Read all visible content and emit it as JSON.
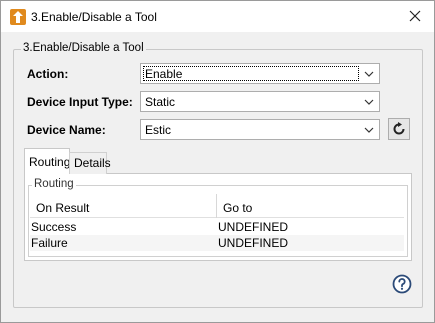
{
  "window": {
    "title": "3.Enable/Disable a Tool"
  },
  "group": {
    "legend": "3.Enable/Disable a Tool"
  },
  "fields": {
    "action": {
      "label": "Action:",
      "value": "Enable"
    },
    "device_input_type": {
      "label": "Device Input Type:",
      "value": "Static"
    },
    "device_name": {
      "label": "Device Name:",
      "value": "Estic"
    }
  },
  "tabs": [
    {
      "label": "Routing",
      "active": true
    },
    {
      "label": "Details",
      "active": false
    }
  ],
  "routing": {
    "legend": "Routing",
    "columns": [
      "On Result",
      "Go to"
    ],
    "rows": [
      {
        "result": "Success",
        "goto": "UNDEFINED"
      },
      {
        "result": "Failure",
        "goto": "UNDEFINED"
      }
    ]
  },
  "colors": {
    "window_bg": "#f0f0f0",
    "panel_bg": "#ffffff",
    "help_icon": "#2b4a78"
  },
  "icons": {
    "app": "tool-app-icon",
    "close": "close-icon",
    "refresh": "refresh-icon",
    "help": "help-icon"
  }
}
